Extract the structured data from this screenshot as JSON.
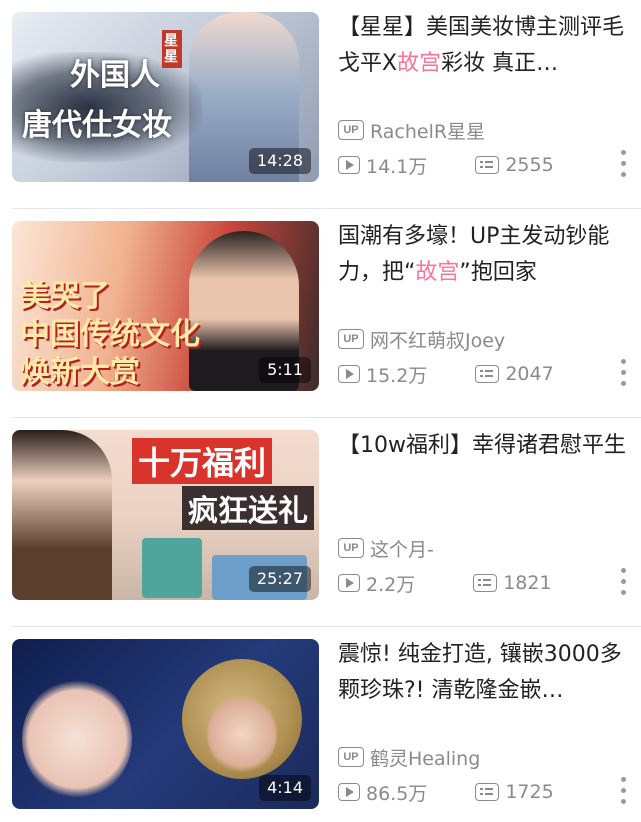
{
  "videos": [
    {
      "title_parts": [
        "【星星】美国美妆博主测评毛戈平X",
        "故宫",
        "彩妆 真正…"
      ],
      "up_name": "RachelR星星",
      "views": "14.1万",
      "danmaku": "2555",
      "duration": "14:28",
      "thumb_text": [
        "外国人",
        "唐代仕女妆",
        "星星"
      ],
      "thumb_colors": [
        "#b8c2d0",
        "#7d8aa3"
      ]
    },
    {
      "title_parts": [
        "国潮有多壕！UP主发动钞能力，把“",
        "故宫",
        "”抱回家"
      ],
      "up_name": "网不红萌叔Joey",
      "views": "15.2万",
      "danmaku": "2047",
      "duration": "5:11",
      "thumb_text": [
        "美哭了",
        "中国传统文化",
        "焕新大赏"
      ],
      "thumb_colors": [
        "#c73a3a",
        "#e7a37b"
      ]
    },
    {
      "title_parts": [
        "【10w福利】幸得诸君慰平生",
        "",
        ""
      ],
      "up_name": "这个月-",
      "views": "2.2万",
      "danmaku": "1821",
      "duration": "25:27",
      "thumb_text": [
        "十万福利",
        "疯狂送礼"
      ],
      "thumb_colors": [
        "#e9c9b4",
        "#5aa6a0"
      ]
    },
    {
      "title_parts": [
        "震惊! 纯金打造, 镶嵌3000多颗珍珠?! 清乾隆金嵌…",
        "",
        ""
      ],
      "up_name": "鹤灵Healing",
      "views": "86.5万",
      "danmaku": "1725",
      "duration": "4:14",
      "thumb_text": [],
      "thumb_colors": [
        "#1c2f63",
        "#c9a45a"
      ]
    }
  ],
  "badge_label": "UP",
  "highlight_color": "#fb7299"
}
